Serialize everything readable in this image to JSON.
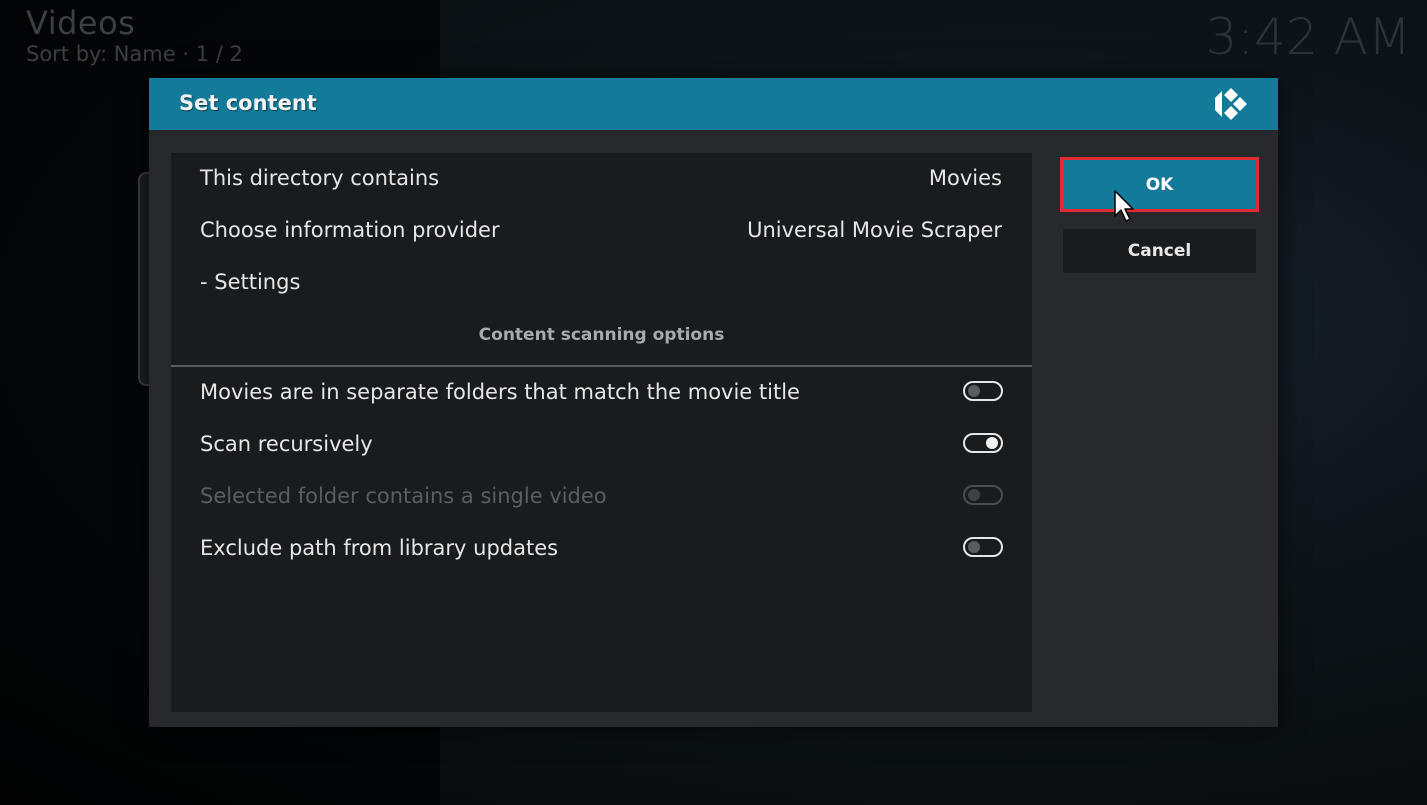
{
  "background": {
    "section_title": "Videos",
    "sort_info": "Sort by: Name  ·  1 / 2",
    "clock": "3:42 AM"
  },
  "dialog": {
    "title": "Set content",
    "logo_icon": "kodi-logo-icon",
    "rows": [
      {
        "label": "This directory contains",
        "value": "Movies"
      },
      {
        "label": "Choose information provider",
        "value": "Universal Movie Scraper"
      },
      {
        "label": "- Settings",
        "value": ""
      }
    ],
    "section_header": "Content scanning options",
    "options": [
      {
        "label": "Movies are in separate folders that match the movie title",
        "enabled": false,
        "disabled": false
      },
      {
        "label": "Scan recursively",
        "enabled": true,
        "disabled": false
      },
      {
        "label": "Selected folder contains a single video",
        "enabled": false,
        "disabled": true
      },
      {
        "label": "Exclude path from library updates",
        "enabled": false,
        "disabled": false
      }
    ],
    "buttons": {
      "ok_label": "OK",
      "cancel_label": "Cancel"
    }
  },
  "colors": {
    "accent": "#137a9a",
    "highlight_outline": "#e02b35",
    "panel": "#1a1b1d",
    "dialog_bg": "#27292c"
  }
}
